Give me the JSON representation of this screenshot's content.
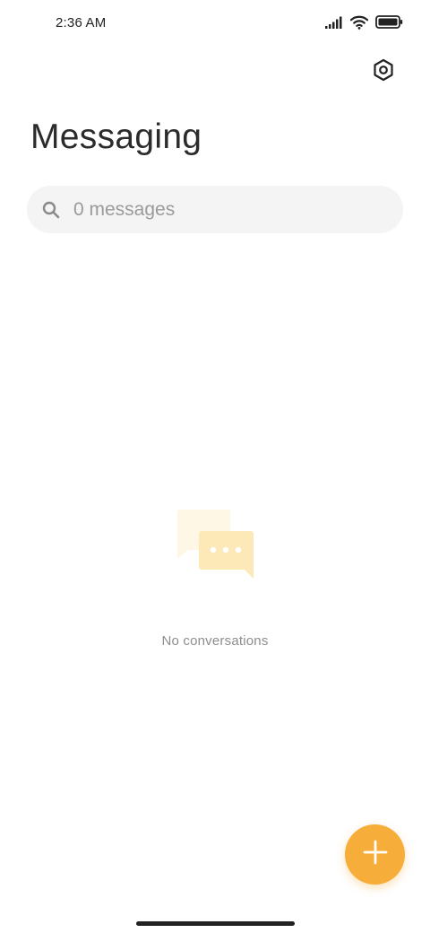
{
  "status_bar": {
    "time": "2:36 AM",
    "icons": [
      "signal-icon",
      "wifi-icon",
      "battery-icon"
    ]
  },
  "header": {
    "title": "Messaging",
    "settings_icon": "settings-hexagon-icon"
  },
  "search": {
    "placeholder": "0 messages",
    "value": "",
    "icon": "search-icon"
  },
  "empty_state": {
    "icon": "chat-bubbles-icon",
    "text": "No conversations"
  },
  "fab": {
    "icon": "plus-icon"
  },
  "colors": {
    "accent": "#f6ad3a",
    "illustration_back": "#fff7e6",
    "illustration_front": "#fde9b8",
    "title_text": "#2b2b2b",
    "muted_text": "#8e8e8e",
    "search_bg": "#f4f4f4"
  }
}
